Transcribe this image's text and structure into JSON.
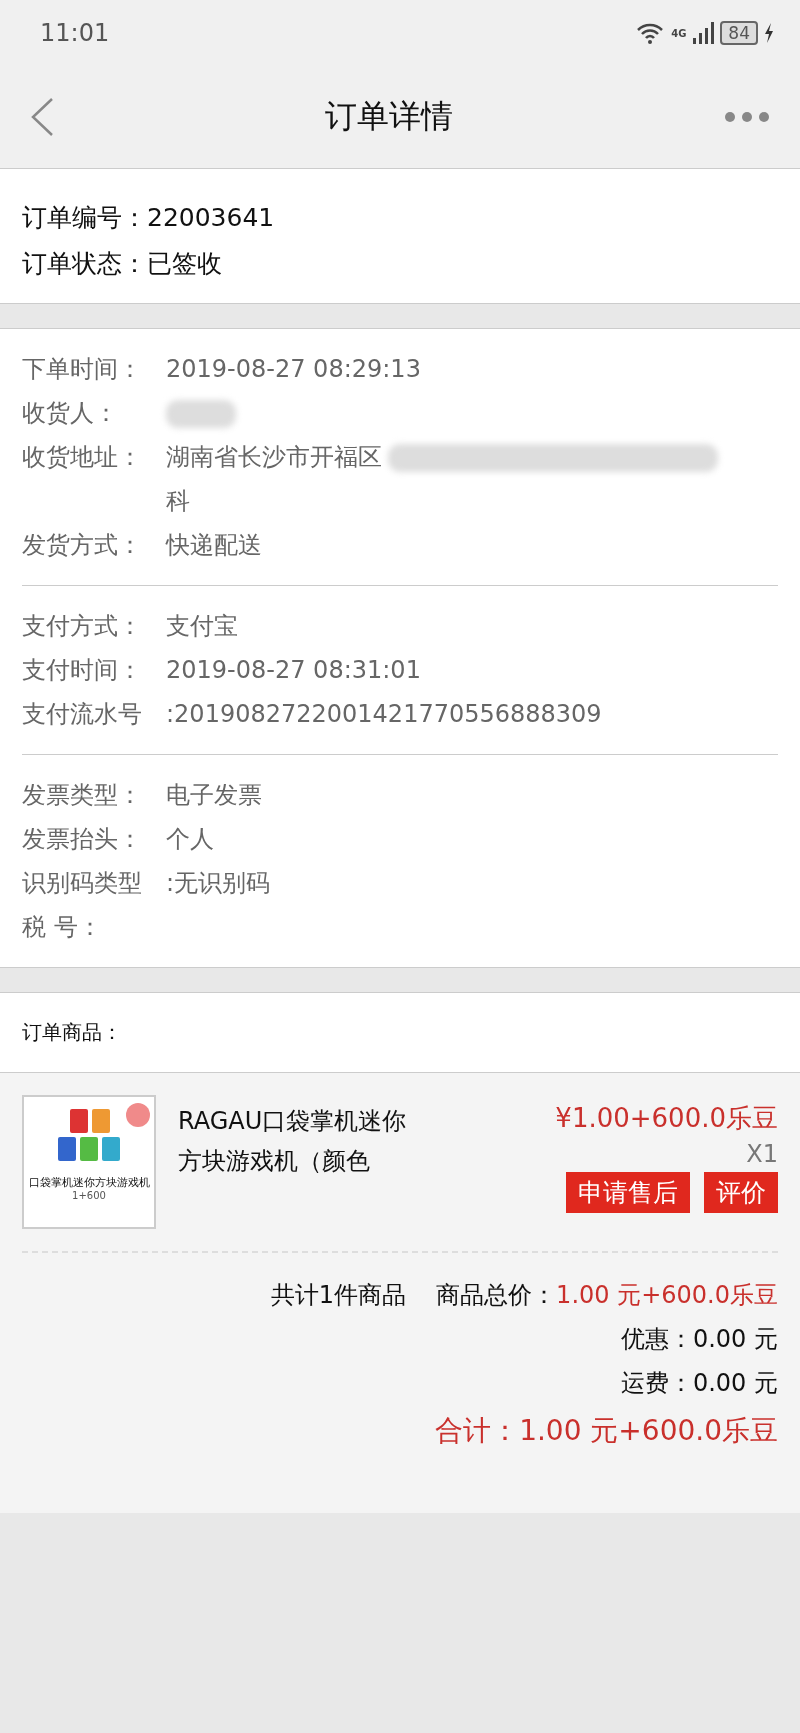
{
  "status_bar": {
    "time": "11:01",
    "network": "4G",
    "battery": "84"
  },
  "header": {
    "title": "订单详情"
  },
  "order": {
    "rows": [
      {
        "label": "订单编号：",
        "value": "22003641"
      },
      {
        "label": "订单状态：",
        "value": "已签收"
      }
    ]
  },
  "detail_groups": [
    {
      "rows": [
        {
          "label": "下单时间：",
          "value": "2019-08-27 08:29:13"
        },
        {
          "label": "收货人：",
          "value": "",
          "kind": "redacted"
        },
        {
          "label": "收货地址：",
          "value": "湖南省长沙市开福区",
          "value_line2": "科",
          "kind": "redacted"
        },
        {
          "label": "发货方式：",
          "value": "快递配送"
        }
      ]
    },
    {
      "rows": [
        {
          "label": "支付方式：",
          "value": "支付宝"
        },
        {
          "label": "支付时间：",
          "value": "2019-08-27 08:31:01"
        },
        {
          "label": "支付流水号",
          "value": ":2019082722001421770556888309"
        }
      ]
    },
    {
      "rows": [
        {
          "label": "发票类型：",
          "value": "电子发票"
        },
        {
          "label": "发票抬头：",
          "value": "个人"
        },
        {
          "label": "识别码类型",
          "value": ":无识别码"
        },
        {
          "label": "税 号：",
          "value": ""
        }
      ]
    }
  ],
  "goods_title": "订单商品：",
  "product": {
    "image": {
      "caption": "口袋掌机迷你方块游戏机",
      "price": "1+600"
    },
    "name": "RAGAU口袋掌机迷你方块游戏机（颜色",
    "price": "¥1.00+600.0乐豆",
    "quantity": "X1",
    "buttons": [
      "申请售后",
      "评价"
    ]
  },
  "summary": {
    "count": "共计1件商品",
    "subtotal_label": "商品总价：",
    "subtotal": "1.00 元+600.0乐豆",
    "discount": "优惠：0.00 元",
    "shipping": "运费：0.00 元",
    "total": "合计：1.00 元+600.0乐豆"
  }
}
